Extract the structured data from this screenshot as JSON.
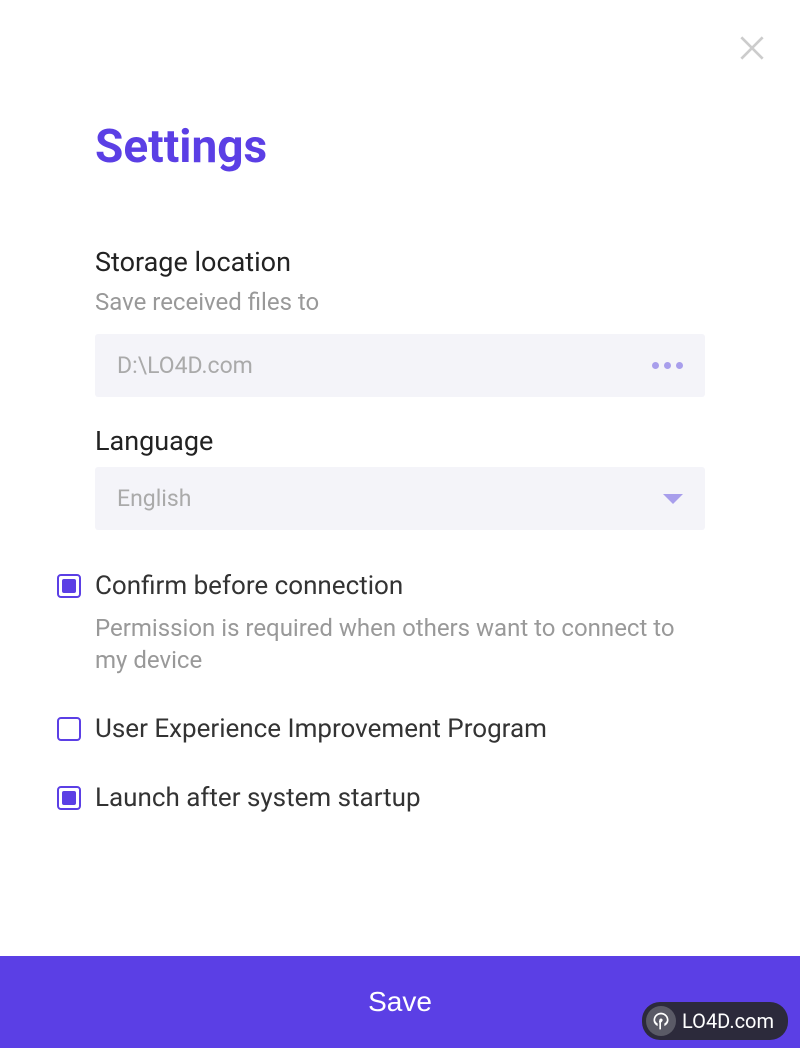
{
  "page": {
    "title": "Settings"
  },
  "storage": {
    "label": "Storage location",
    "sublabel": "Save received files to",
    "value": "D:\\LO4D.com"
  },
  "language": {
    "label": "Language",
    "value": "English"
  },
  "options": {
    "confirm": {
      "label": "Confirm before connection",
      "description": "Permission is required when others want to connect to my device",
      "checked": true
    },
    "uxip": {
      "label": "User Experience Improvement Program",
      "checked": false
    },
    "launch": {
      "label": "Launch after system startup",
      "checked": true
    }
  },
  "actions": {
    "save": "Save"
  },
  "watermark": {
    "text": "LO4D.com"
  }
}
